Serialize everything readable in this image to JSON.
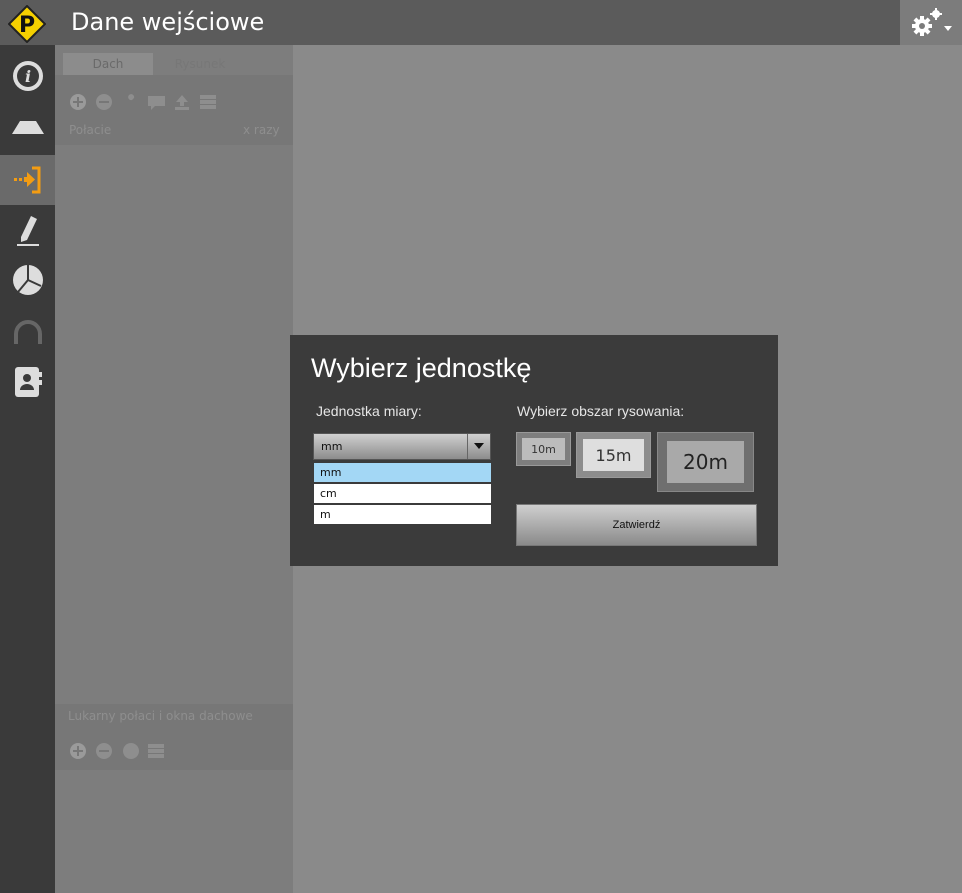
{
  "header": {
    "title": "Dane wejściowe",
    "logo_letter": "P"
  },
  "left_panel": {
    "tabs": [
      "Dach",
      "Rysunek"
    ],
    "list_header": {
      "col1": "Połacie",
      "col2": "x razy"
    },
    "section2_title": "Lukarny połaci i okna dachowe"
  },
  "dialog": {
    "title": "Wybierz jednostkę",
    "unit_label": "Jednostka miary:",
    "unit_selected": "mm",
    "unit_options": [
      "mm",
      "cm",
      "m"
    ],
    "area_label": "Wybierz obszar rysowania:",
    "area_options": [
      "10m",
      "15m",
      "20m"
    ],
    "confirm_label": "Zatwierdź"
  },
  "colors": {
    "accent": "#f39c12",
    "logo_yellow": "#f5d000",
    "selected_option": "#a3d7f5"
  }
}
